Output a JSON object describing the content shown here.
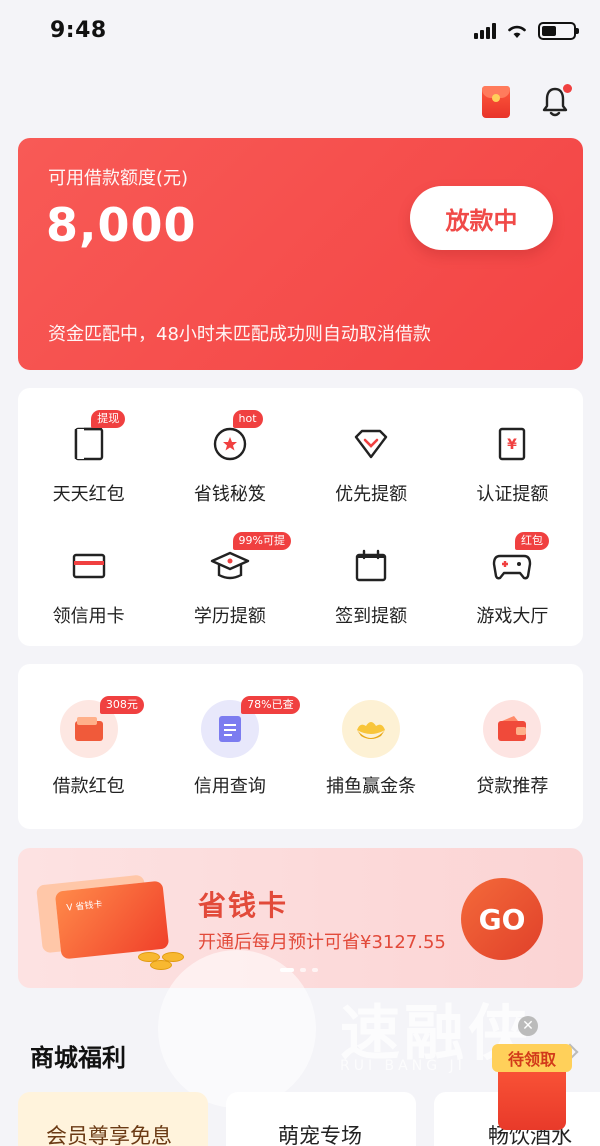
{
  "status_bar": {
    "time": "9:48"
  },
  "loan_card": {
    "label": "可用借款额度(元)",
    "amount": "8,000",
    "status_button": "放款中",
    "notice": "资金匹配中，48小时未匹配成功则自动取消借款"
  },
  "features": [
    {
      "label": "天天红包",
      "badge": "提现",
      "icon": "red-packet-outline-icon"
    },
    {
      "label": "省钱秘笈",
      "badge": "hot",
      "icon": "star-circle-icon"
    },
    {
      "label": "优先提额",
      "badge": "",
      "icon": "diamond-icon"
    },
    {
      "label": "认证提额",
      "badge": "",
      "icon": "yen-card-icon"
    },
    {
      "label": "领信用卡",
      "badge": "",
      "icon": "credit-card-icon"
    },
    {
      "label": "学历提额",
      "badge": "99%可提",
      "icon": "graduation-cap-icon"
    },
    {
      "label": "签到提额",
      "badge": "",
      "icon": "calendar-icon"
    },
    {
      "label": "游戏大厅",
      "badge": "红包",
      "icon": "gamepad-icon"
    }
  ],
  "services": [
    {
      "label": "借款红包",
      "badge": "308元",
      "icon": "wallet-red-icon"
    },
    {
      "label": "信用查询",
      "badge": "78%已查",
      "icon": "document-icon"
    },
    {
      "label": "捕鱼赢金条",
      "badge": "",
      "icon": "gold-ingot-icon"
    },
    {
      "label": "贷款推荐",
      "badge": "",
      "icon": "wallet-recommend-icon"
    }
  ],
  "promo": {
    "title": "省钱卡",
    "subtitle": "开通后每月预计可省¥3127.55",
    "go_label": "GO",
    "card_text": "V 省钱卡"
  },
  "watermark": {
    "text": "速融侠",
    "sub": "RUI BANG JI"
  },
  "mall": {
    "title": "商城福利",
    "cards": [
      "会员尊享免息",
      "萌宠专场",
      "畅饮酒水"
    ]
  },
  "float_ad": {
    "tag": "待领取"
  },
  "colors": {
    "primary_red": "#f34444",
    "promo_text": "#e24a3a"
  }
}
